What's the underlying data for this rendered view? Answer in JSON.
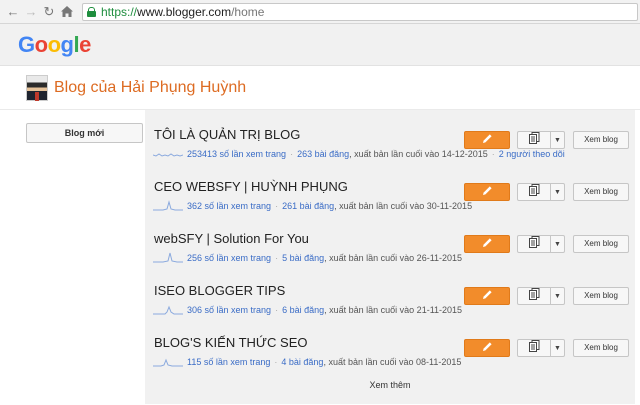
{
  "browser": {
    "url_secure": "https://",
    "url_host": "www.blogger.com",
    "url_path": "/home"
  },
  "google_logo": [
    "G",
    "o",
    "o",
    "g",
    "l",
    "e"
  ],
  "header": {
    "blog_title": "Blog của Hải Phụng Huỳnh"
  },
  "sidebar": {
    "new_blog_label": "Blog mới"
  },
  "blogs": [
    {
      "title": "TÔI LÀ QUẢN TRỊ BLOG",
      "views": "253413 số lần xem trang",
      "posts": "263 bài đăng",
      "published": "xuất bản lần cuối vào 14-12-2015",
      "followers": "2 người theo dõi"
    },
    {
      "title": "CEO WEBSFY | HUỲNH PHỤNG",
      "views": "362 số lần xem trang",
      "posts": "261 bài đăng",
      "published": "xuất bản lần cuối vào 30-11-2015"
    },
    {
      "title": "webSFY | Solution For You",
      "views": "256 số lần xem trang",
      "posts": "5 bài đăng",
      "published": "xuất bản lần cuối vào 26-11-2015"
    },
    {
      "title": "ISEO BLOGGER TIPS",
      "views": "306 số lần xem trang",
      "posts": "6 bài đăng",
      "published": "xuất bản lần cuối vào 21-11-2015"
    },
    {
      "title": "BLOG'S KIẾN THỨC SEO",
      "views": "115 số lần xem trang",
      "posts": "4 bài đăng",
      "published": "xuất bản lần cuối vào 08-11-2015"
    }
  ],
  "view_blog_label": "Xem blog",
  "see_more_label": "Xem thêm",
  "icons": {
    "edit": "pencil-icon",
    "posts": "copy-icon",
    "menu": "caret-down-icon"
  },
  "colors": {
    "accent_orange": "#f28c2b",
    "title_orange": "#dd6b22",
    "link_blue": "#3a6cc6"
  }
}
